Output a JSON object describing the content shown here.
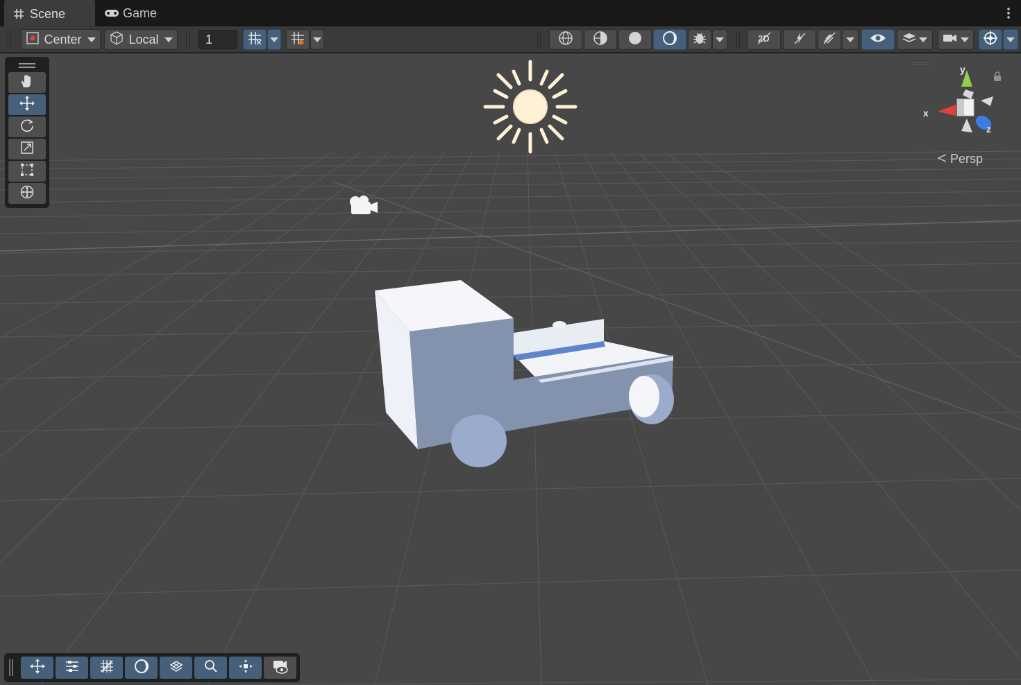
{
  "tabs": {
    "scene_label": "Scene",
    "game_label": "Game"
  },
  "toolbar": {
    "pivot_label": "Center",
    "space_label": "Local",
    "grid_size_value": "1"
  },
  "gizmo": {
    "x_label": "x",
    "y_label": "y",
    "z_label": "z",
    "projection_label": "Persp"
  },
  "tools": [
    "hand-tool",
    "move-tool",
    "rotate-tool",
    "scale-tool",
    "rect-tool",
    "transform-tool"
  ],
  "active_tool": "move-tool",
  "colors": {
    "accent": "#46607c",
    "viewport_bg": "#474747",
    "grid_line": "#595959",
    "x_axis": "#e0413b",
    "y_axis": "#8fd14f",
    "z_axis": "#3f7be6",
    "model": "#9aabcc",
    "sun": "#fff1d6"
  }
}
